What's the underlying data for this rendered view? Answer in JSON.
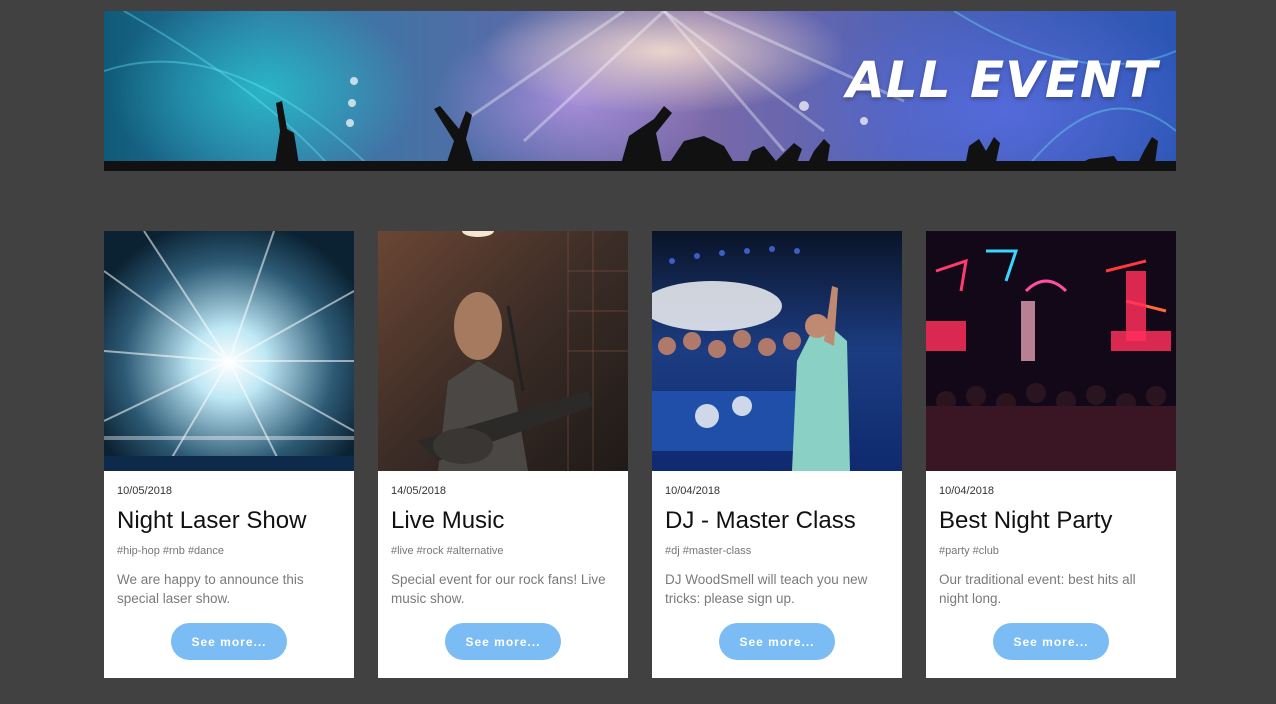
{
  "banner": {
    "title": "ALL EVENT",
    "image": "concert-crowd-image"
  },
  "events": [
    {
      "date": "10/05/2018",
      "title": "Night Laser Show",
      "tags": "#hip-hop #rnb #dance",
      "description": "We are happy to announce this special laser show.",
      "button": "See more...",
      "image": "laser-light-image"
    },
    {
      "date": "14/05/2018",
      "title": "Live Music",
      "tags": "#live #rock #alternative",
      "description": "Special event for our rock fans! Live music show.",
      "button": "See more...",
      "image": "guitarist-singer-image"
    },
    {
      "date": "10/04/2018",
      "title": "DJ - Master Class",
      "tags": "#dj #master-class",
      "description": "DJ WoodSmell will teach you new tricks: please sign up.",
      "button": "See more...",
      "image": "dj-crowd-image"
    },
    {
      "date": "10/04/2018",
      "title": "Best Night Party",
      "tags": "#party #club",
      "description": "Our traditional event: best hits all night long.",
      "button": "See more...",
      "image": "neon-street-image"
    }
  ],
  "colors": {
    "background": "#414141",
    "card": "#ffffff",
    "button": "#7bbcf5",
    "title": "#111111",
    "text": "#7a7a7a"
  }
}
